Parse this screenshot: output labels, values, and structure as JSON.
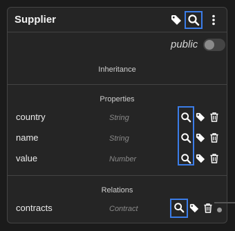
{
  "node": {
    "title": "Supplier",
    "header_icons": [
      "tag-icon",
      "search-icon",
      "more-vertical-icon"
    ],
    "public_label": "public",
    "public_toggle_on": false
  },
  "sections": {
    "inheritance_title": "Inheritance",
    "properties_title": "Properties",
    "relations_title": "Relations"
  },
  "properties": [
    {
      "name": "country",
      "type": "String"
    },
    {
      "name": "name",
      "type": "String"
    },
    {
      "name": "value",
      "type": "Number"
    }
  ],
  "relations": [
    {
      "name": "contracts",
      "type": "Contract"
    }
  ],
  "colors": {
    "highlight": "#3b7de9",
    "card_bg": "#252525",
    "background": "#1b1b1b",
    "divider": "#444444"
  }
}
